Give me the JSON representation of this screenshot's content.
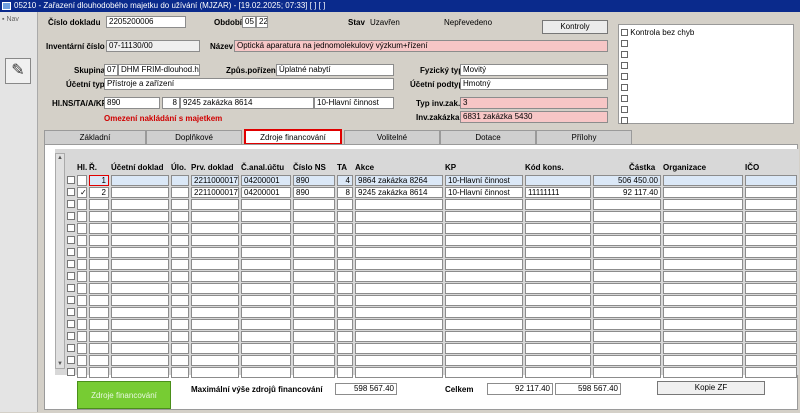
{
  "window": {
    "title": "05210 - Zařazení dlouhodobého majetku do užívání (MJZAR) - [19.02.2025; 07:33] [ ] [ ]"
  },
  "left": {
    "nav_label": "Nav"
  },
  "header": {
    "cislo_dokladu_label": "Číslo dokladu",
    "cislo_dokladu": "2205200006",
    "obdobi_label": "Období",
    "obdobi_month": "05",
    "obdobi_year": "22",
    "stav_label": "Stav",
    "stav": "Uzavřen",
    "stav2": "Nepřevedeno",
    "kontroly_label": "Kontroly",
    "inventarni_label": "Inventární číslo",
    "inventarni": "07-11130/00",
    "nazev_label": "Název",
    "nazev": "Optická aparatura na jednomolekulový výzkum+řízení",
    "skupina_label": "Skupina",
    "skupina_code": "07",
    "skupina": "DHM FRIM-dlouhod.hm",
    "zpusob_label": "Způs.pořízení",
    "zpusob": "Úplatné nabytí",
    "fyzicky_label": "Fyzický typ",
    "fyzicky": "Movitý",
    "ucetni_typ_label": "Účetní typ",
    "ucetni_typ": "Přístroje a zařízení",
    "ucetni_podtyp_label": "Účetní podtyp",
    "ucetni_podtyp": "Hmotný",
    "hlns_label": "Hl.NS/TA/A/KP",
    "hlns": "890",
    "ta": "8",
    "akce": "9245 zakázka 8614",
    "kp": "10-Hlavní činnost",
    "typ_inv_label": "Typ inv.zak.",
    "typ_inv": "3",
    "warning": "Omezení nakládání s majetkem",
    "inv_zakazka_label": "Inv.zakázka",
    "inv_zakazka": "6831 zakázka 5430"
  },
  "right_panel": {
    "kontrola_label": "Kontrola bez chyb"
  },
  "tabs": [
    "Základní",
    "Doplňkové",
    "Zdroje financování",
    "Volitelné",
    "Dotace",
    "Přílohy"
  ],
  "grid": {
    "headers": [
      "Hl.",
      "Ř.",
      "Účetní doklad",
      "Úlo.",
      "Prv. doklad",
      "Č.anal.účtu",
      "Číslo NS",
      "TA",
      "Akce",
      "KP",
      "Kód kons.",
      "Částka",
      "Organizace",
      "IČO"
    ],
    "rows": [
      {
        "hl": "",
        "r": "1",
        "doklad": "",
        "ulo": "",
        "prv": "2211000017",
        "anal": "04200001",
        "ns": "890",
        "ta": "4",
        "akce": "9864 zakázka 8264",
        "kp": "10-Hlavní činnost",
        "kod": "",
        "castka": "506 450.00",
        "org": "",
        "ico": ""
      },
      {
        "hl": "✓",
        "r": "2",
        "doklad": "",
        "ulo": "",
        "prv": "2211000017",
        "anal": "04200001",
        "ns": "890",
        "ta": "8",
        "akce": "9245 zakázka 8614",
        "kp": "10-Hlavní činnost",
        "kod": "11111111",
        "castka": "92 117.40",
        "org": "",
        "ico": ""
      }
    ]
  },
  "footer": {
    "zdroje_button": "Zdroje financování",
    "max_label": "Maximální výše zdrojů financování",
    "max_value": "598 567.40",
    "celkem_label": "Celkem",
    "celkem_value1": "92 117.40",
    "celkem_value2": "598 567.40",
    "kopie_button": "Kopie ZF"
  }
}
